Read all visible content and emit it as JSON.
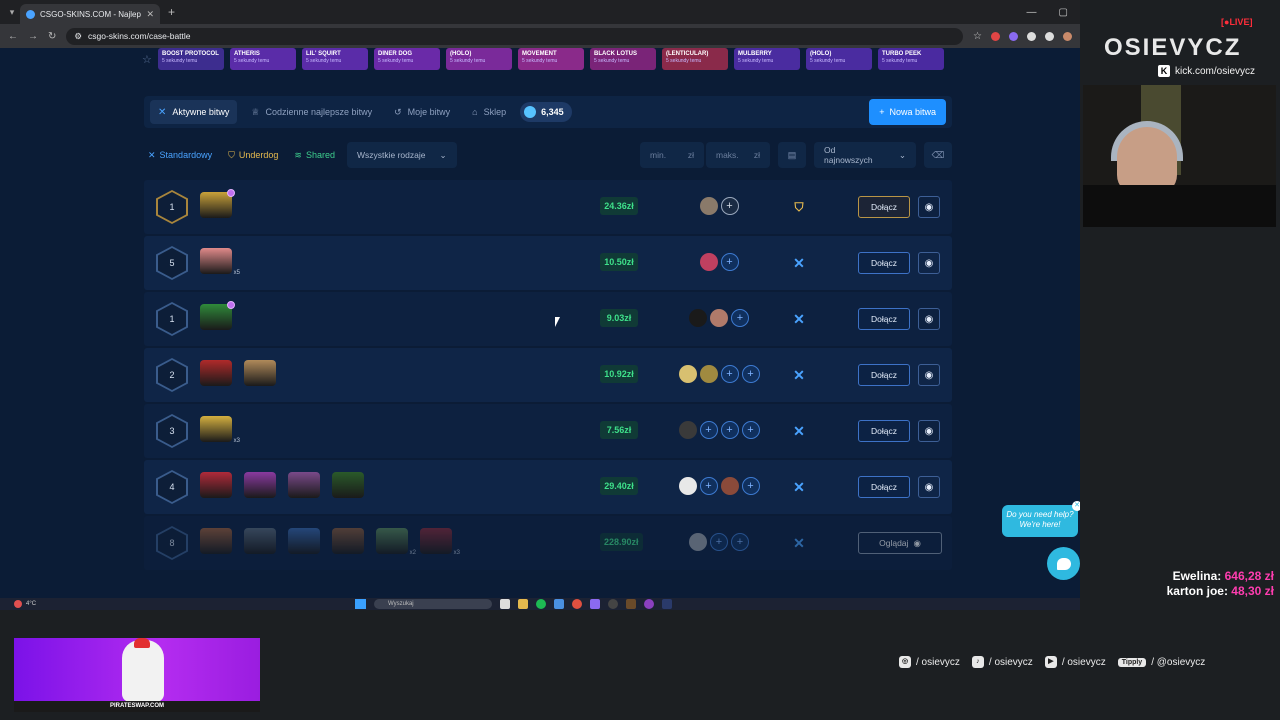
{
  "browser": {
    "tab_title": "CSGO-SKINS.COM - Najlepsze",
    "url": "csgo-skins.com/case-battle"
  },
  "ticker": [
    {
      "name": "BOOST PROTOCOL",
      "sub": "5 sekundy temu",
      "color": "#3d2d8f"
    },
    {
      "name": "ATHERIS",
      "sub": "5 sekundy temu",
      "color": "#5a2ca8"
    },
    {
      "name": "LIL' SQUIRT",
      "sub": "5 sekundy temu",
      "color": "#5a2ca8"
    },
    {
      "name": "DINER DOG",
      "sub": "5 sekundy temu",
      "color": "#6a2aa8"
    },
    {
      "name": "(HOLO)",
      "sub": "5 sekundy temu",
      "color": "#7a2a9a"
    },
    {
      "name": "MOVEMENT",
      "sub": "5 sekundy temu",
      "color": "#8a2a8a"
    },
    {
      "name": "BLACK LOTUS",
      "sub": "5 sekundy temu",
      "color": "#7a2478"
    },
    {
      "name": "(LENTICULAR)",
      "sub": "5 sekundy temu",
      "color": "#8a2a4a"
    },
    {
      "name": "MULBERRY",
      "sub": "5 sekundy temu",
      "color": "#4a2ca0"
    },
    {
      "name": "(HOLO)",
      "sub": "5 sekundy temu",
      "color": "#4a2ca0"
    },
    {
      "name": "TURBO PEEK",
      "sub": "5 sekundy temu",
      "color": "#4a2aa0"
    }
  ],
  "nav": {
    "tabs": [
      "Aktywne bitwy",
      "Codzienne najlepsze bitwy",
      "Moje bitwy",
      "Sklep"
    ],
    "coins": "6,345",
    "new_battle": "Nowa bitwa"
  },
  "filters": {
    "standard": "Standardowy",
    "underdog": "Underdog",
    "shared": "Shared",
    "all_types": "Wszystkie rodzaje",
    "min_placeholder": "min.",
    "max_placeholder": "maks.",
    "currency": "zł",
    "sort": "Od najnowszych"
  },
  "battles": [
    {
      "rounds": "1",
      "price": "24.36zł",
      "mode": "underdog",
      "action": "Dołącz",
      "cases": [
        {
          "color": "#c9a23a",
          "mult": "",
          "dot": true
        }
      ],
      "players": [
        "#8a7a6a"
      ],
      "slots": 1
    },
    {
      "rounds": "5",
      "price": "10.50zł",
      "mode": "standard",
      "action": "Dołącz",
      "cases": [
        {
          "color": "#e08a8a",
          "mult": "x5",
          "dot": false
        }
      ],
      "players": [
        "#c04060"
      ],
      "slots": 1
    },
    {
      "rounds": "1",
      "price": "9.03zł",
      "mode": "standard",
      "action": "Dołącz",
      "cases": [
        {
          "color": "#2f8a3a",
          "mult": "",
          "dot": true
        }
      ],
      "players": [
        "#1a1a1a",
        "#b07a6a"
      ],
      "slots": 1
    },
    {
      "rounds": "2",
      "price": "10.92zł",
      "mode": "standard",
      "action": "Dołącz",
      "cases": [
        {
          "color": "#b02a2a",
          "mult": "",
          "dot": false
        },
        {
          "color": "#b08a5a",
          "mult": "",
          "dot": false
        }
      ],
      "players": [
        "#d8c070",
        "#a08a40"
      ],
      "slots": 2
    },
    {
      "rounds": "3",
      "price": "7.56zł",
      "mode": "standard",
      "action": "Dołącz",
      "cases": [
        {
          "color": "#d4b040",
          "mult": "x3",
          "dot": false
        }
      ],
      "players": [
        "#3a3a3a"
      ],
      "slots": 3
    },
    {
      "rounds": "4",
      "price": "29.40zł",
      "mode": "standard",
      "action": "Dołącz",
      "cases": [
        {
          "color": "#b02a3a",
          "mult": "",
          "dot": false
        },
        {
          "color": "#8a3aa0",
          "mult": "",
          "dot": false
        },
        {
          "color": "#7a4a8a",
          "mult": "",
          "dot": false
        },
        {
          "color": "#2a5a2a",
          "mult": "",
          "dot": false
        }
      ],
      "players": [
        "#e8e8e8"
      ],
      "slots": 1,
      "late_players": [
        "#8a4a3a"
      ],
      "late_slots": 1
    },
    {
      "rounds": "8",
      "price": "228.90zł",
      "mode": "standard",
      "action": "Oglądaj",
      "cases": [
        {
          "color": "#a0603a",
          "mult": "",
          "dot": false
        },
        {
          "color": "#5a6a7a",
          "mult": "",
          "dot": false
        },
        {
          "color": "#3a6ab0",
          "mult": "",
          "dot": false
        },
        {
          "color": "#8a5a3a",
          "mult": "",
          "dot": false
        },
        {
          "color": "#5a8a5a",
          "mult": "x2",
          "dot": false
        },
        {
          "color": "#8a2a3a",
          "mult": "x3",
          "dot": false
        }
      ],
      "players": [
        "#9aa0a8"
      ],
      "slots": 2,
      "dim": true
    }
  ],
  "help": {
    "text": "Do you need help? We're here!"
  },
  "taskbar": {
    "temp": "4°C",
    "search": "Wyszukaj"
  },
  "overlay": {
    "live": "LIVE",
    "brand": "OSIEVYCZ",
    "kick": "kick.com/osievycz",
    "donors": [
      {
        "name": "Ewelina:",
        "amount": "646,28 zł"
      },
      {
        "name": "karton joe:",
        "amount": "48,30 zł"
      }
    ],
    "ad": "PIRATESWAP.COM",
    "socials": {
      "instagram": "/ osievycz",
      "tiktok": "/ osievycz",
      "youtube": "/ osievycz",
      "tipply_label": "Tipply",
      "tipply": "/ @osievycz"
    }
  }
}
